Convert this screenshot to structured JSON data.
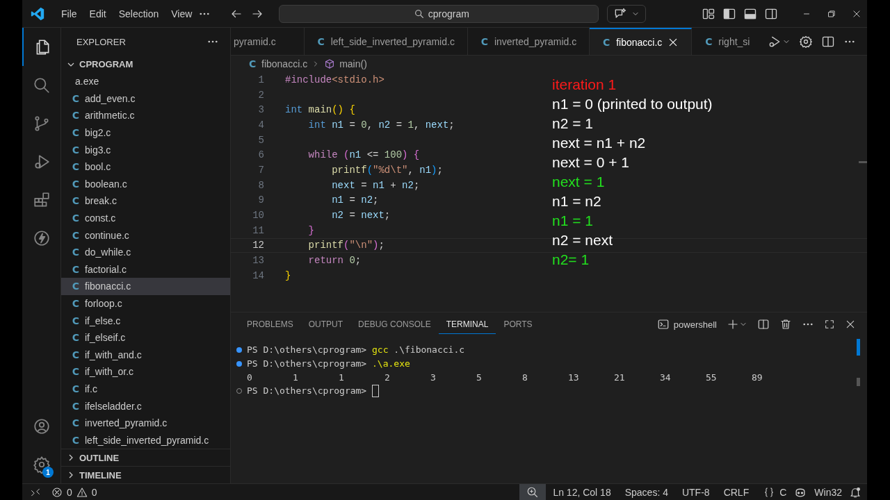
{
  "title_bar": {
    "menu": [
      "File",
      "Edit",
      "Selection",
      "View"
    ],
    "search": {
      "value": "cprogram"
    }
  },
  "explorer": {
    "title": "EXPLORER",
    "folder": {
      "name": "CPROGRAM",
      "expanded": true
    },
    "files": [
      {
        "name": "a.exe",
        "selected": false
      },
      {
        "icon": "C",
        "name": "add_even.c",
        "selected": false
      },
      {
        "icon": "C",
        "name": "arithmetic.c",
        "selected": false
      },
      {
        "icon": "C",
        "name": "big2.c",
        "selected": false
      },
      {
        "icon": "C",
        "name": "big3.c",
        "selected": false
      },
      {
        "icon": "C",
        "name": "bool.c",
        "selected": false
      },
      {
        "icon": "C",
        "name": "boolean.c",
        "selected": false
      },
      {
        "icon": "C",
        "name": "break.c",
        "selected": false
      },
      {
        "icon": "C",
        "name": "const.c",
        "selected": false
      },
      {
        "icon": "C",
        "name": "continue.c",
        "selected": false
      },
      {
        "icon": "C",
        "name": "do_while.c",
        "selected": false
      },
      {
        "icon": "C",
        "name": "factorial.c",
        "selected": false
      },
      {
        "icon": "C",
        "name": "fibonacci.c",
        "selected": true
      },
      {
        "icon": "C",
        "name": "forloop.c",
        "selected": false
      },
      {
        "icon": "C",
        "name": "if_else.c",
        "selected": false
      },
      {
        "icon": "C",
        "name": "if_elseif.c",
        "selected": false
      },
      {
        "icon": "C",
        "name": "if_with_and.c",
        "selected": false
      },
      {
        "icon": "C",
        "name": "if_with_or.c",
        "selected": false
      },
      {
        "icon": "C",
        "name": "if.c",
        "selected": false
      },
      {
        "icon": "C",
        "name": "ifelseladder.c",
        "selected": false
      },
      {
        "icon": "C",
        "name": "inverted_pyramid.c",
        "selected": false
      },
      {
        "icon": "C",
        "name": "left_side_inverted_pyramid.c",
        "selected": false
      }
    ],
    "sections": [
      {
        "name": "OUTLINE",
        "expanded": false
      },
      {
        "name": "TIMELINE",
        "expanded": false
      }
    ]
  },
  "activity_bar": {
    "settings_badge": "1"
  },
  "tabs": [
    {
      "label": "pyramid.c",
      "selected": false
    },
    {
      "icon": "C",
      "label": "left_side_inverted_pyramid.c",
      "selected": false
    },
    {
      "icon": "C",
      "label": "inverted_pyramid.c",
      "selected": false
    },
    {
      "icon": "C",
      "label": "fibonacci.c",
      "selected": true
    },
    {
      "icon": "C",
      "label": "right_si",
      "selected": false
    }
  ],
  "breadcrumb": {
    "icon": "C",
    "file": "fibonacci.c",
    "symbol": "main()"
  },
  "code": [
    {
      "number": "1",
      "current": false,
      "tokens": [
        {
          "kind": "macro",
          "text": "#include"
        },
        {
          "kind": "string",
          "text": "<stdio.h>"
        }
      ]
    },
    {
      "number": "2",
      "current": false
    },
    {
      "number": "3",
      "current": false,
      "tokens": [
        {
          "kind": "keyword",
          "text": "int "
        },
        {
          "kind": "function",
          "text": "main"
        },
        {
          "kind": "brace1",
          "text": "() {"
        }
      ]
    },
    {
      "number": "4",
      "current": false,
      "tokens": [
        {
          "kind": "keyword",
          "text": "    int "
        },
        {
          "kind": "variable",
          "text": "n1"
        },
        {
          "kind": "plain",
          "text": " = "
        },
        {
          "kind": "number",
          "text": "0"
        },
        {
          "kind": "plain",
          "text": ", "
        },
        {
          "kind": "variable",
          "text": "n2"
        },
        {
          "kind": "plain",
          "text": " = "
        },
        {
          "kind": "number",
          "text": "1"
        },
        {
          "kind": "plain",
          "text": ", "
        },
        {
          "kind": "variable",
          "text": "next"
        },
        {
          "kind": "plain",
          "text": ";"
        }
      ]
    },
    {
      "number": "5",
      "current": false
    },
    {
      "number": "6",
      "current": false,
      "tokens": [
        {
          "kind": "control",
          "text": "    while "
        },
        {
          "kind": "brace2",
          "text": "("
        },
        {
          "kind": "variable",
          "text": "n1"
        },
        {
          "kind": "plain",
          "text": " <= "
        },
        {
          "kind": "number",
          "text": "100"
        },
        {
          "kind": "brace2",
          "text": ") {"
        }
      ]
    },
    {
      "number": "7",
      "current": false,
      "tokens": [
        {
          "kind": "function",
          "text": "        printf"
        },
        {
          "kind": "brace3",
          "text": "("
        },
        {
          "kind": "string",
          "text": "\"%d\\t\""
        },
        {
          "kind": "plain",
          "text": ", "
        },
        {
          "kind": "variable",
          "text": "n1"
        },
        {
          "kind": "brace3",
          "text": ")"
        },
        {
          "kind": "plain",
          "text": ";"
        }
      ]
    },
    {
      "number": "8",
      "current": false,
      "tokens": [
        {
          "kind": "variable",
          "text": "        next"
        },
        {
          "kind": "plain",
          "text": " = "
        },
        {
          "kind": "variable",
          "text": "n1"
        },
        {
          "kind": "plain",
          "text": " + "
        },
        {
          "kind": "variable",
          "text": "n2"
        },
        {
          "kind": "plain",
          "text": ";"
        }
      ]
    },
    {
      "number": "9",
      "current": false,
      "tokens": [
        {
          "kind": "variable",
          "text": "        n1"
        },
        {
          "kind": "plain",
          "text": " = "
        },
        {
          "kind": "variable",
          "text": "n2"
        },
        {
          "kind": "plain",
          "text": ";"
        }
      ]
    },
    {
      "number": "10",
      "current": false,
      "tokens": [
        {
          "kind": "variable",
          "text": "        n2"
        },
        {
          "kind": "plain",
          "text": " = "
        },
        {
          "kind": "variable",
          "text": "next"
        },
        {
          "kind": "plain",
          "text": ";"
        }
      ]
    },
    {
      "number": "11",
      "current": false,
      "tokens": [
        {
          "kind": "brace2",
          "text": "    }"
        }
      ]
    },
    {
      "number": "12",
      "current": true,
      "tokens": [
        {
          "kind": "function",
          "text": "    printf"
        },
        {
          "kind": "brace2",
          "text": "("
        },
        {
          "kind": "string",
          "text": "\"\\n\""
        },
        {
          "kind": "brace2",
          "text": ")"
        },
        {
          "kind": "plain",
          "text": ";"
        }
      ]
    },
    {
      "number": "13",
      "current": false,
      "tokens": [
        {
          "kind": "control",
          "text": "    return "
        },
        {
          "kind": "number",
          "text": "0"
        },
        {
          "kind": "plain",
          "text": ";"
        }
      ]
    },
    {
      "number": "14",
      "current": false,
      "tokens": [
        {
          "kind": "brace1",
          "text": "}"
        }
      ]
    }
  ],
  "annotation": [
    {
      "text": "iteration 1",
      "color": "#ff1a1a"
    },
    {
      "text": "n1 = 0 (printed to output)",
      "color": "#ffffff"
    },
    {
      "text": "n2 = 1",
      "color": "#ffffff"
    },
    {
      "text": "next = n1 + n2",
      "color": "#ffffff"
    },
    {
      "text": "next = 0 + 1",
      "color": "#ffffff"
    },
    {
      "text": "next = 1",
      "color": "#22e01e"
    },
    {
      "text": "n1 = n2",
      "color": "#ffffff"
    },
    {
      "text": "n1 = 1",
      "color": "#22e01e"
    },
    {
      "text": "n2 = next",
      "color": "#ffffff"
    },
    {
      "text": "n2= 1",
      "color": "#22e01e"
    }
  ],
  "panel": {
    "tabs": [
      {
        "label": "PROBLEMS",
        "selected": false
      },
      {
        "label": "OUTPUT",
        "selected": false
      },
      {
        "label": "DEBUG CONSOLE",
        "selected": false
      },
      {
        "label": "TERMINAL",
        "selected": true
      },
      {
        "label": "PORTS",
        "selected": false
      }
    ],
    "shell": "powershell",
    "terminal": [
      {
        "kind": "command",
        "prompt": "PS D:\\others\\cprogram>",
        "program": "gcc",
        "args": ".\\fibonacci.c"
      },
      {
        "kind": "command",
        "prompt": "PS D:\\others\\cprogram>",
        "program": ".\\a.exe"
      },
      {
        "kind": "output",
        "values": [
          "0",
          "1",
          "1",
          "2",
          "3",
          "5",
          "8",
          "13",
          "21",
          "34",
          "55",
          "89"
        ]
      },
      {
        "kind": "prompt",
        "prompt": "PS D:\\others\\cprogram>"
      }
    ]
  },
  "status_bar": {
    "errors": "0",
    "warnings": "0",
    "position": "Ln 12, Col 18",
    "indent": "Spaces: 4",
    "encoding": "UTF-8",
    "eol": "CRLF",
    "language": "C",
    "platform": "Win32"
  }
}
